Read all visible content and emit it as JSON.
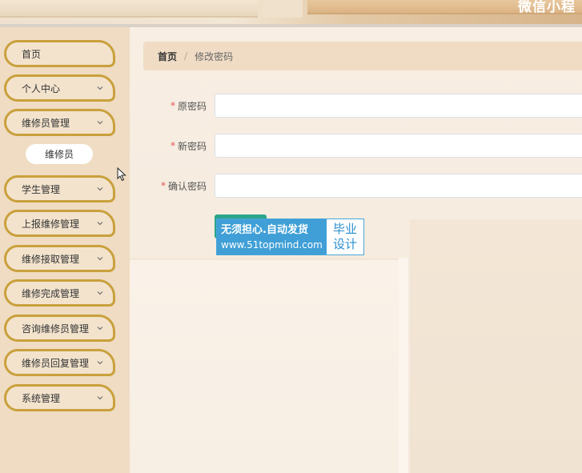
{
  "header": {
    "site_title": "微信小程"
  },
  "sidebar": {
    "items": [
      {
        "label": "首页",
        "has_chevron": false
      },
      {
        "label": "个人中心",
        "has_chevron": true
      },
      {
        "label": "维修员管理",
        "has_chevron": true
      },
      {
        "label": "学生管理",
        "has_chevron": true
      },
      {
        "label": "上报维修管理",
        "has_chevron": true
      },
      {
        "label": "维修接取管理",
        "has_chevron": true
      },
      {
        "label": "维修完成管理",
        "has_chevron": true
      },
      {
        "label": "咨询维修员管理",
        "has_chevron": true
      },
      {
        "label": "维修员回复管理",
        "has_chevron": true
      },
      {
        "label": "系统管理",
        "has_chevron": true
      }
    ],
    "submenu": {
      "label": "维修员"
    },
    "accent_color": "#c9a03c"
  },
  "breadcrumb": {
    "home": "首页",
    "separator": "/",
    "current": "修改密码"
  },
  "form": {
    "required_mark": "*",
    "fields": [
      {
        "label": "原密码",
        "value": ""
      },
      {
        "label": "新密码",
        "value": ""
      },
      {
        "label": "确认密码",
        "value": ""
      }
    ],
    "submit_color": "#2aa58a"
  },
  "watermark": {
    "line1": "无须担心.自动发货",
    "line2": "www.51topmind.com",
    "right_line1": "毕业",
    "right_line2": "设计"
  }
}
